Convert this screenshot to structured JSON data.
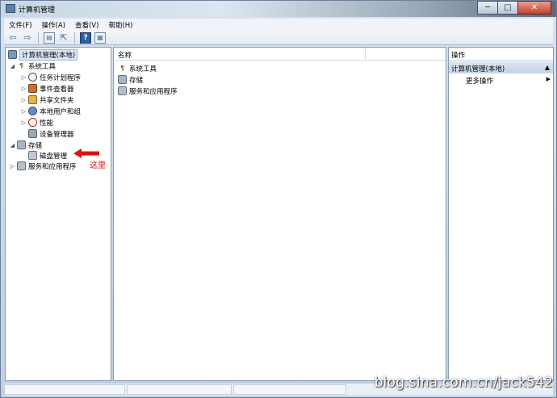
{
  "window": {
    "title": "计算机管理",
    "controls": {
      "minimize": "─",
      "maximize": "□",
      "close": "✕"
    }
  },
  "menubar": {
    "items": [
      "文件(F)",
      "操作(A)",
      "查看(V)",
      "帮助(H)"
    ]
  },
  "toolbar": {
    "back": "⇦",
    "forward": "⇨",
    "console": "▤",
    "export": "⇱",
    "help": "?",
    "view": "▦"
  },
  "tree": {
    "root": "计算机管理(本地)",
    "system_tools": "系统工具",
    "task_scheduler": "任务计划程序",
    "event_viewer": "事件查看器",
    "shared_folders": "共享文件夹",
    "local_users": "本地用户和组",
    "performance": "性能",
    "device_manager": "设备管理器",
    "storage": "存储",
    "disk_management": "磁盘管理",
    "services": "服务和应用程序",
    "expander_open": "◢",
    "expander_closed": "▷"
  },
  "list": {
    "column_name": "名称",
    "rows": [
      "系统工具",
      "存储",
      "服务和应用程序"
    ]
  },
  "actions": {
    "header": "操作",
    "section_title": "计算机管理(本地)",
    "section_caret": "▲",
    "more_actions": "更多操作",
    "more_caret": "▶"
  },
  "annotation": {
    "label": "这里",
    "color": "#e01010"
  },
  "watermark": "blog.sina.com.cn/jack542"
}
